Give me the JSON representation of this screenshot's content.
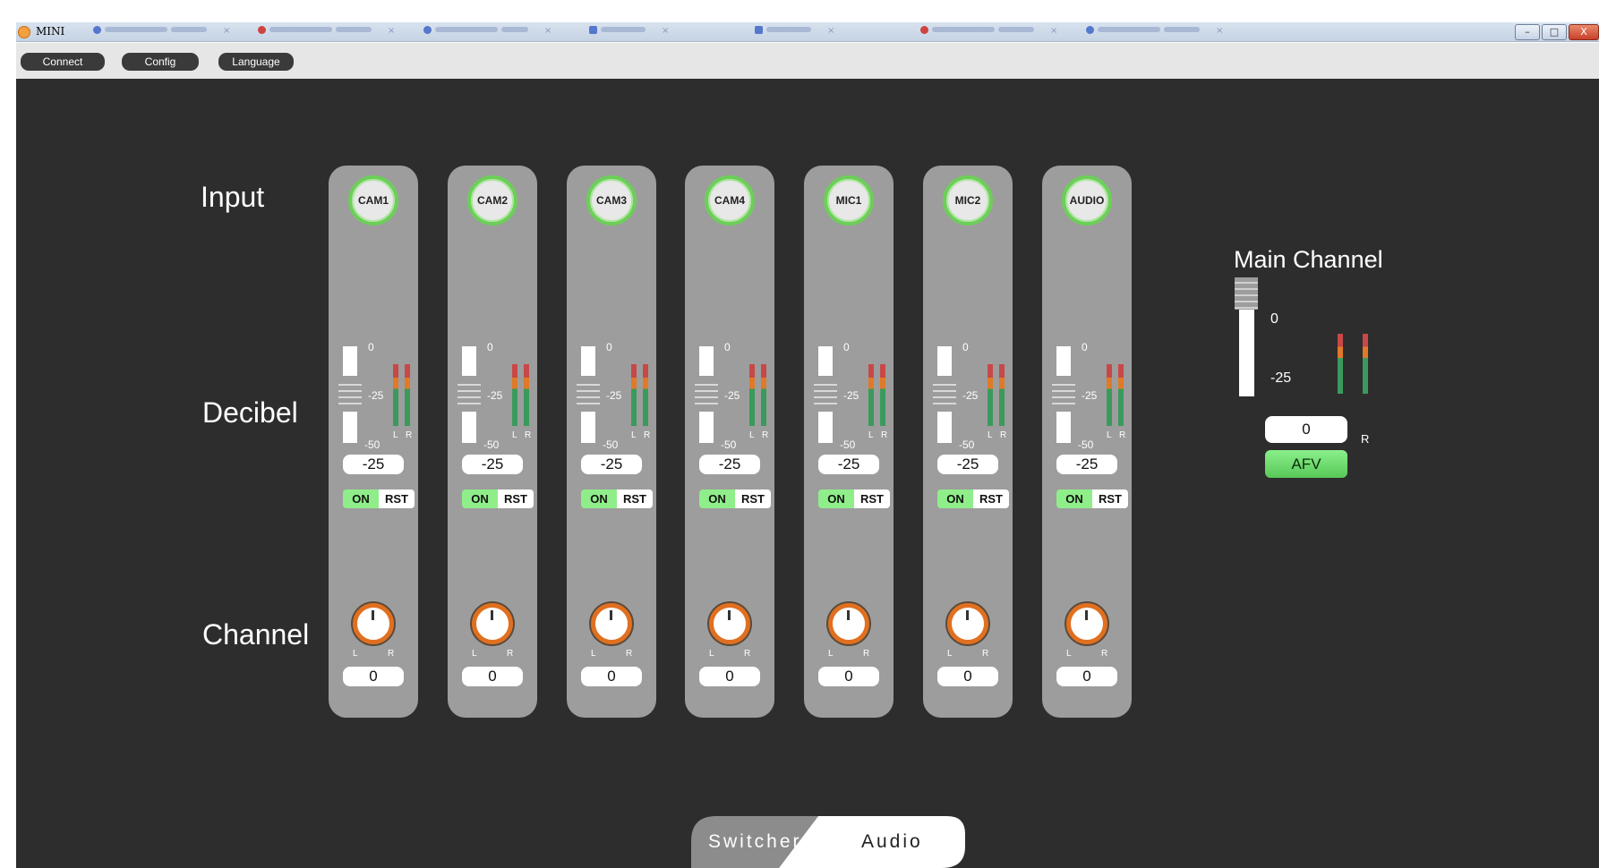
{
  "window": {
    "title": "MINI",
    "controls": {
      "minimize": "–",
      "maximize": "□",
      "close": "X"
    }
  },
  "menu": {
    "connect": "Connect",
    "config": "Config",
    "language": "Language"
  },
  "row_labels": {
    "input": "Input",
    "decibel": "Decibel",
    "channel": "Channel"
  },
  "scale": {
    "top": "0",
    "mid": "-25",
    "bottom": "-50",
    "left": "L",
    "right": "R"
  },
  "channels": [
    {
      "name": "CAM1",
      "db": "-25",
      "pan": "0",
      "on": "ON",
      "rst": "RST"
    },
    {
      "name": "CAM2",
      "db": "-25",
      "pan": "0",
      "on": "ON",
      "rst": "RST"
    },
    {
      "name": "CAM3",
      "db": "-25",
      "pan": "0",
      "on": "ON",
      "rst": "RST"
    },
    {
      "name": "CAM4",
      "db": "-25",
      "pan": "0",
      "on": "ON",
      "rst": "RST"
    },
    {
      "name": "MIC1",
      "db": "-25",
      "pan": "0",
      "on": "ON",
      "rst": "RST"
    },
    {
      "name": "MIC2",
      "db": "-25",
      "pan": "0",
      "on": "ON",
      "rst": "RST"
    },
    {
      "name": "AUDIO",
      "db": "-25",
      "pan": "0",
      "on": "ON",
      "rst": "RST"
    }
  ],
  "main_channel": {
    "title": "Main Channel",
    "value": "0",
    "afv": "AFV"
  },
  "mode": {
    "switcher": "Switcher",
    "audio": "Audio",
    "active": "Audio"
  },
  "colors": {
    "background": "#2d2d2d",
    "strip": "#9d9d9d",
    "on_green": "#8fee8a",
    "knob_orange": "#e07020"
  }
}
